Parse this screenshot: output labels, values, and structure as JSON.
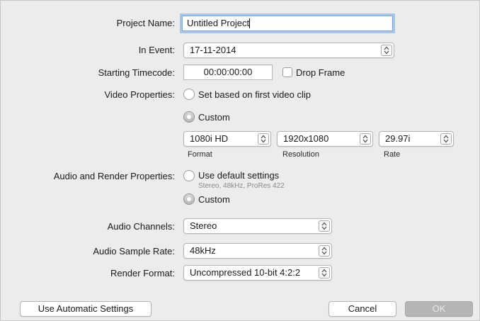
{
  "project_name": {
    "label": "Project Name:",
    "value": "Untitled Project"
  },
  "in_event": {
    "label": "In Event:",
    "value": "17-11-2014"
  },
  "starting_timecode": {
    "label": "Starting Timecode:",
    "value": "00:00:00:00",
    "drop_frame_label": "Drop Frame",
    "drop_frame_checked": false
  },
  "video_properties": {
    "label": "Video Properties:",
    "option_first_clip": "Set based on first video clip",
    "option_custom": "Custom",
    "selected": "custom",
    "format": {
      "value": "1080i HD",
      "caption": "Format"
    },
    "resolution": {
      "value": "1920x1080",
      "caption": "Resolution"
    },
    "rate": {
      "value": "29.97i",
      "caption": "Rate"
    }
  },
  "audio_render": {
    "label": "Audio and Render Properties:",
    "option_default": "Use default settings",
    "default_detail": "Stereo, 48kHz, ProRes 422",
    "option_custom": "Custom",
    "selected": "custom"
  },
  "audio_channels": {
    "label": "Audio Channels:",
    "value": "Stereo"
  },
  "audio_sample_rate": {
    "label": "Audio Sample Rate:",
    "value": "48kHz"
  },
  "render_format": {
    "label": "Render Format:",
    "value": "Uncompressed 10-bit 4:2:2"
  },
  "buttons": {
    "automatic": "Use Automatic Settings",
    "cancel": "Cancel",
    "ok": "OK"
  },
  "icons": {
    "stepper": "updown-arrows-icon"
  }
}
